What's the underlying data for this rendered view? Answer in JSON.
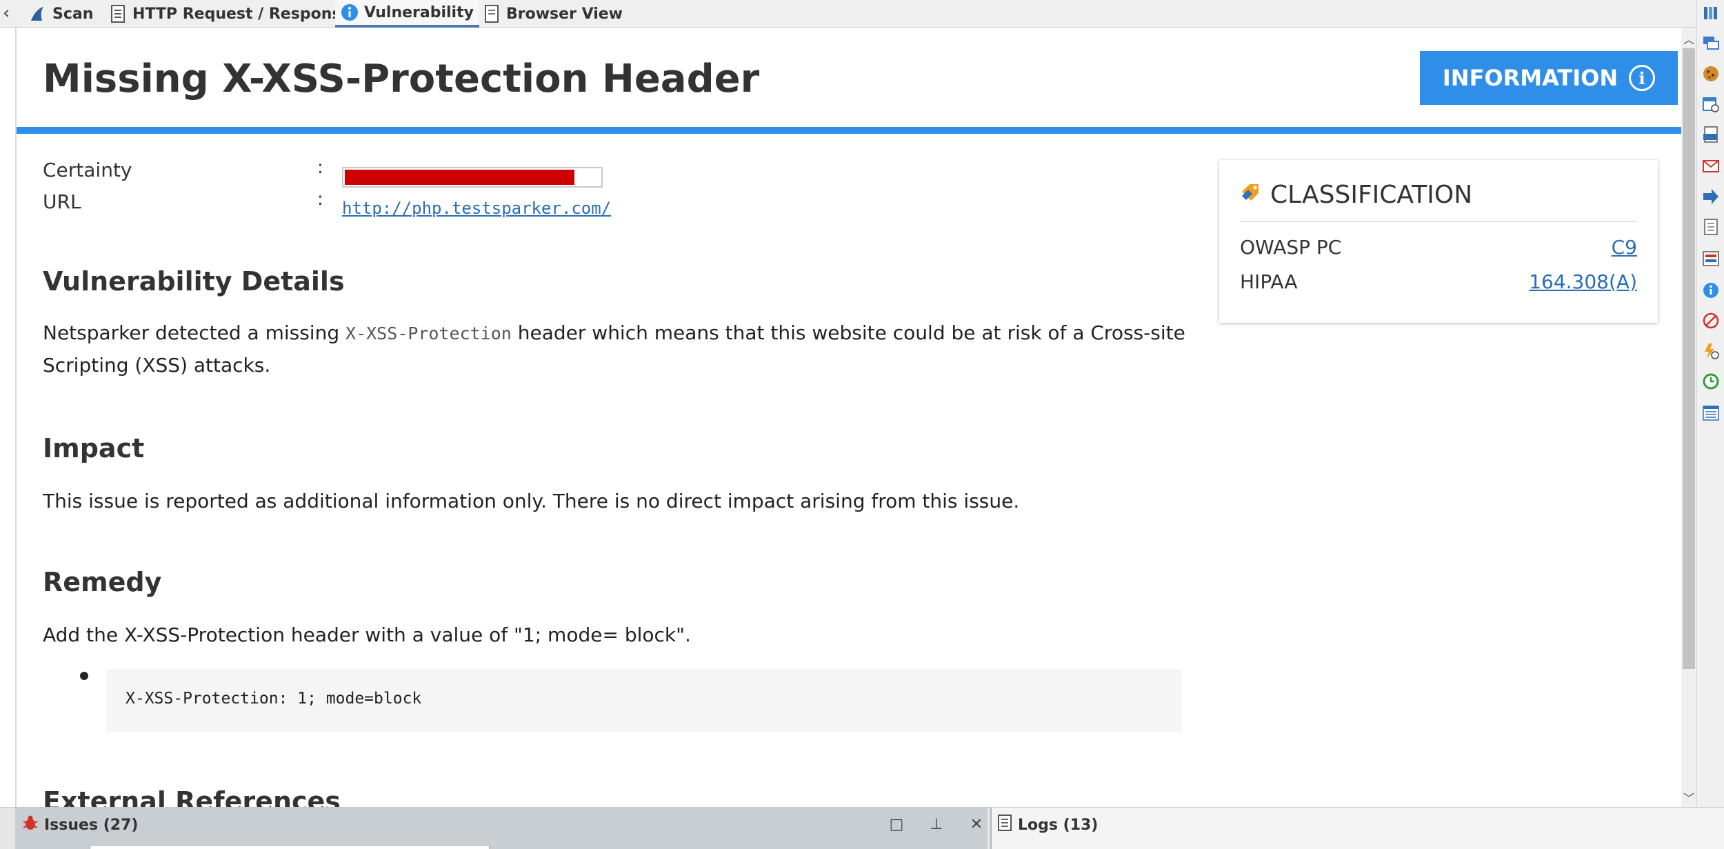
{
  "tabs": [
    {
      "label": "Scan",
      "icon": "shark-fin-icon"
    },
    {
      "label": "HTTP Request / Response",
      "icon": "document-icon"
    },
    {
      "label": "Vulnerability",
      "icon": "info-icon"
    },
    {
      "label": "Browser View",
      "icon": "page-icon"
    }
  ],
  "active_tab": "Vulnerability",
  "vulnerability": {
    "title": "Missing X-XSS-Protection Header",
    "severity_label": "INFORMATION",
    "severity_color": "#2f8fe8",
    "certainty_label": "Certainty",
    "certainty_percent": 90,
    "url_label": "URL",
    "url": "http://php.testsparker.com/"
  },
  "details": {
    "heading": "Vulnerability Details",
    "text_before": "Netsparker detected a missing ",
    "code": "X-XSS-Protection",
    "text_after": " header which means that this website could be at risk of a Cross-site Scripting (XSS) attacks."
  },
  "impact": {
    "heading": "Impact",
    "text": "This issue is reported as additional information only. There is no direct impact arising from this issue."
  },
  "remedy": {
    "heading": "Remedy",
    "text": "Add the X-XSS-Protection header with a value of \"1; mode= block\".",
    "code": "X-XSS-Protection: 1; mode=block"
  },
  "external_references": {
    "heading": "External References"
  },
  "classification": {
    "heading": "CLASSIFICATION",
    "rows": [
      {
        "label": "OWASP PC",
        "value": "C9"
      },
      {
        "label": "HIPAA",
        "value": "164.308(A)"
      }
    ]
  },
  "bottom": {
    "issues_label": "Issues (27)",
    "logs_label": "Logs (13)"
  },
  "colors": {
    "accent": "#2f8fe8",
    "link": "#2a6db5",
    "certainty_fill": "#cc0000"
  }
}
